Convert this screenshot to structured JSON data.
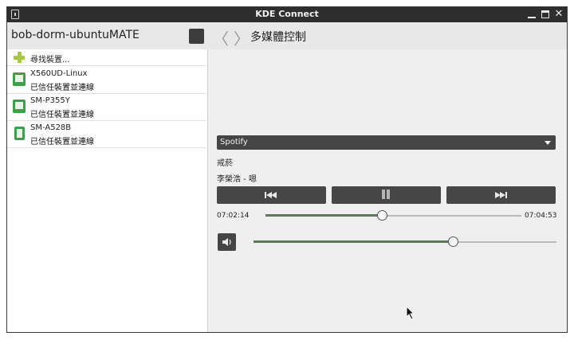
{
  "window": {
    "title": "KDE Connect",
    "close_glyph": "✕"
  },
  "toolbar": {
    "device_title": "bob-dorm-ubuntuMATE",
    "back_glyph": "〈",
    "forward_glyph": "〉",
    "page_title": "多媒體控制"
  },
  "sidebar": {
    "find_label": "尋找裝置...",
    "devices": [
      {
        "name": "X560UD-Linux",
        "status": "已信任裝置並連線",
        "icon": "laptop-icon"
      },
      {
        "name": "SM-P355Y",
        "status": "已信任裝置並連線",
        "icon": "tablet-icon"
      },
      {
        "name": "SM-A528B",
        "status": "已信任裝置並連線",
        "icon": "phone-icon"
      }
    ]
  },
  "player": {
    "selected": "Spotify",
    "song": "戒菸",
    "artist": "李榮浩 - 嗯",
    "current_time": "07:02:14",
    "total_time": "07:04:53",
    "progress": 0.455,
    "volume": 0.66
  },
  "colors": {
    "accent": "#3aa24a",
    "plus": "#a5c93b",
    "titlebar": "#2e2e2e",
    "button": "#464646"
  }
}
